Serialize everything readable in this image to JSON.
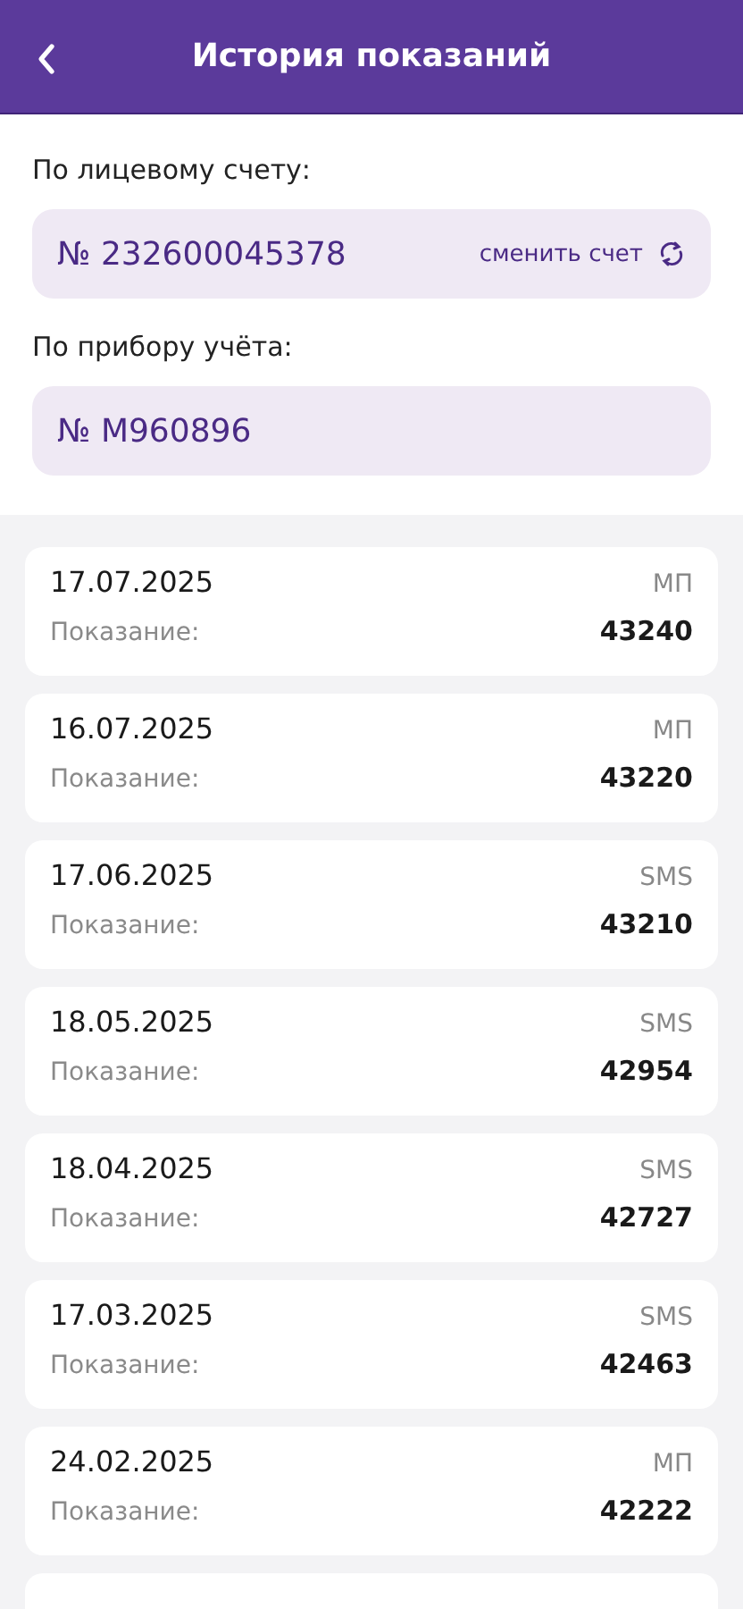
{
  "header": {
    "title": "История показаний"
  },
  "account": {
    "label": "По лицевому счету:",
    "value": "№ 232600045378",
    "change_link": "сменить счет"
  },
  "meter": {
    "label": "По прибору учёта:",
    "value": "№ М960896"
  },
  "readings": [
    {
      "date": "17.07.2025",
      "source": "МП",
      "label": "Показание:",
      "value": "43240"
    },
    {
      "date": "16.07.2025",
      "source": "МП",
      "label": "Показание:",
      "value": "43220"
    },
    {
      "date": "17.06.2025",
      "source": "SMS",
      "label": "Показание:",
      "value": "43210"
    },
    {
      "date": "18.05.2025",
      "source": "SMS",
      "label": "Показание:",
      "value": "42954"
    },
    {
      "date": "18.04.2025",
      "source": "SMS",
      "label": "Показание:",
      "value": "42727"
    },
    {
      "date": "17.03.2025",
      "source": "SMS",
      "label": "Показание:",
      "value": "42463"
    },
    {
      "date": "24.02.2025",
      "source": "МП",
      "label": "Показание:",
      "value": "42222"
    }
  ]
}
